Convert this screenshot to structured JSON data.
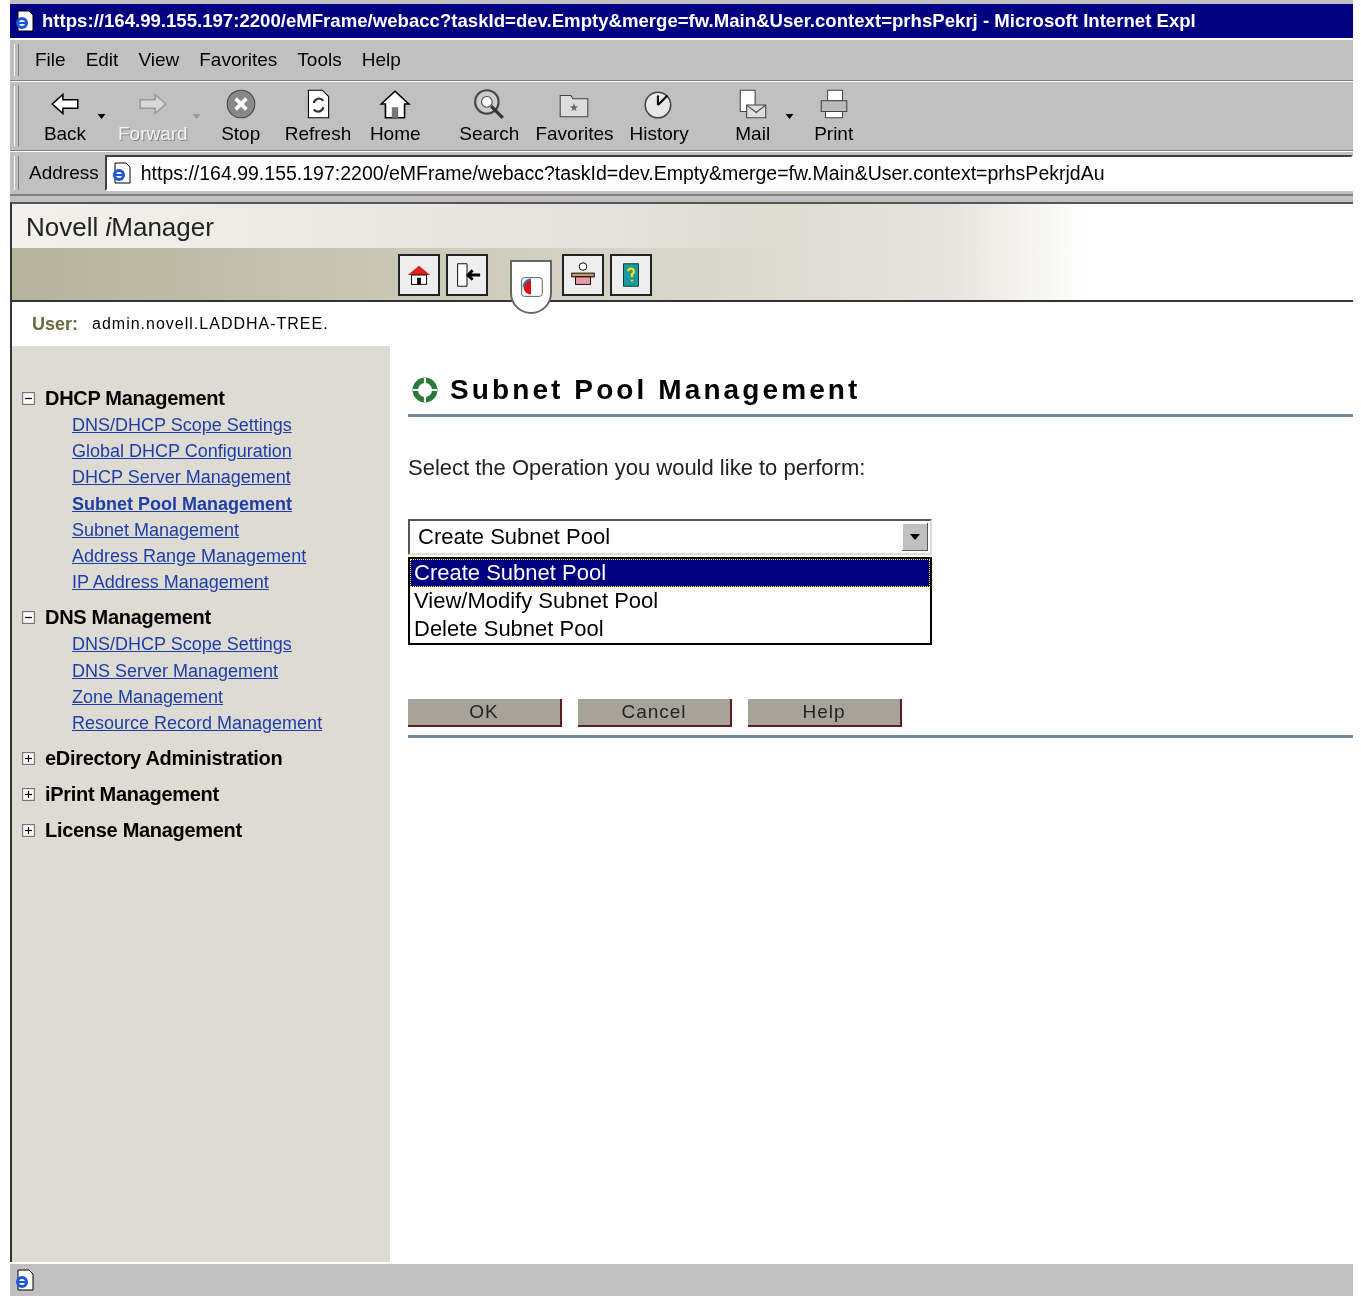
{
  "window": {
    "title": "https://164.99.155.197:2200/eMFrame/webacc?taskId=dev.Empty&merge=fw.Main&User.context=prhsPekrj - Microsoft Internet Expl"
  },
  "menu": [
    {
      "label": "File"
    },
    {
      "label": "Edit"
    },
    {
      "label": "View"
    },
    {
      "label": "Favorites"
    },
    {
      "label": "Tools"
    },
    {
      "label": "Help"
    }
  ],
  "toolbar": [
    {
      "kind": "back",
      "label": "Back",
      "disabled": false,
      "dropdown": true,
      "separator_before": false
    },
    {
      "kind": "forward",
      "label": "Forward",
      "disabled": true,
      "dropdown": true,
      "separator_before": false
    },
    {
      "kind": "stop",
      "label": "Stop",
      "disabled": false,
      "dropdown": false,
      "separator_before": false
    },
    {
      "kind": "refresh",
      "label": "Refresh",
      "disabled": false,
      "dropdown": false,
      "separator_before": false
    },
    {
      "kind": "home",
      "label": "Home",
      "disabled": false,
      "dropdown": false,
      "separator_before": false
    },
    {
      "kind": "search",
      "label": "Search",
      "disabled": false,
      "dropdown": false,
      "separator_before": true
    },
    {
      "kind": "favorites",
      "label": "Favorites",
      "disabled": false,
      "dropdown": false,
      "separator_before": false
    },
    {
      "kind": "history",
      "label": "History",
      "disabled": false,
      "dropdown": false,
      "separator_before": false
    },
    {
      "kind": "mail",
      "label": "Mail",
      "disabled": false,
      "dropdown": true,
      "separator_before": true
    },
    {
      "kind": "print",
      "label": "Print",
      "disabled": false,
      "dropdown": false,
      "separator_before": false
    }
  ],
  "address": {
    "label": "Address",
    "value": "https://164.99.155.197:2200/eMFrame/webacc?taskId=dev.Empty&merge=fw.Main&User.context=prhsPekrjdAu"
  },
  "app": {
    "vendor": "Novell",
    "prefix": "i",
    "product": "Manager"
  },
  "header_icons": [
    {
      "kind": "home",
      "selected": false
    },
    {
      "kind": "exit",
      "selected": false
    },
    {
      "kind": "roles",
      "selected": true
    },
    {
      "kind": "desk",
      "selected": false
    },
    {
      "kind": "help",
      "selected": false
    }
  ],
  "user": {
    "label": "User:",
    "value": "admin.novell.LADDHA-TREE."
  },
  "sidebar": [
    {
      "label": "DHCP Management",
      "expanded": true,
      "children": [
        {
          "label": "DNS/DHCP Scope Settings",
          "selected": false
        },
        {
          "label": "Global DHCP Configuration",
          "selected": false
        },
        {
          "label": "DHCP Server Management",
          "selected": false
        },
        {
          "label": "Subnet Pool Management",
          "selected": true
        },
        {
          "label": "Subnet Management",
          "selected": false
        },
        {
          "label": "Address Range Management",
          "selected": false
        },
        {
          "label": "IP Address Management",
          "selected": false
        }
      ]
    },
    {
      "label": "DNS Management",
      "expanded": true,
      "children": [
        {
          "label": "DNS/DHCP Scope Settings",
          "selected": false
        },
        {
          "label": "DNS Server Management",
          "selected": false
        },
        {
          "label": "Zone Management",
          "selected": false
        },
        {
          "label": "Resource Record Management",
          "selected": false
        }
      ]
    },
    {
      "label": "eDirectory Administration",
      "expanded": false
    },
    {
      "label": "iPrint Management",
      "expanded": false
    },
    {
      "label": "License Management",
      "expanded": false
    }
  ],
  "page": {
    "heading": "Subnet Pool Management",
    "prompt": "Select the Operation you would like to perform:",
    "select": {
      "value": "Create Subnet Pool",
      "expanded": true,
      "options": [
        {
          "label": "Create Subnet Pool",
          "selected": true
        },
        {
          "label": "View/Modify Subnet Pool",
          "selected": false
        },
        {
          "label": "Delete Subnet Pool",
          "selected": false
        }
      ]
    },
    "buttons": [
      "OK",
      "Cancel",
      "Help"
    ]
  }
}
